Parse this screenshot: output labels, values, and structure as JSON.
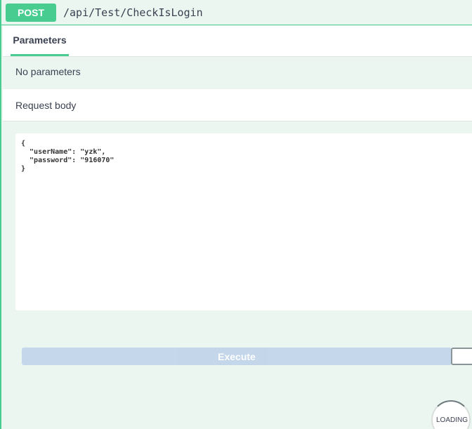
{
  "operation": {
    "method": "POST",
    "path": "/api/Test/CheckIsLogin"
  },
  "tabs": {
    "parameters": "Parameters"
  },
  "parameters": {
    "empty_text": "No parameters"
  },
  "request_body": {
    "label": "Request body",
    "code": "{\n  \"userName\": \"yzk\",\n  \"password\": \"916070\"\n}"
  },
  "actions": {
    "execute_label": "Execute"
  },
  "status": {
    "loading_text": "LOADING"
  },
  "colors": {
    "accent": "#49cc90",
    "background": "#ebf6f1",
    "execute_disabled": "#c2d5ea"
  }
}
